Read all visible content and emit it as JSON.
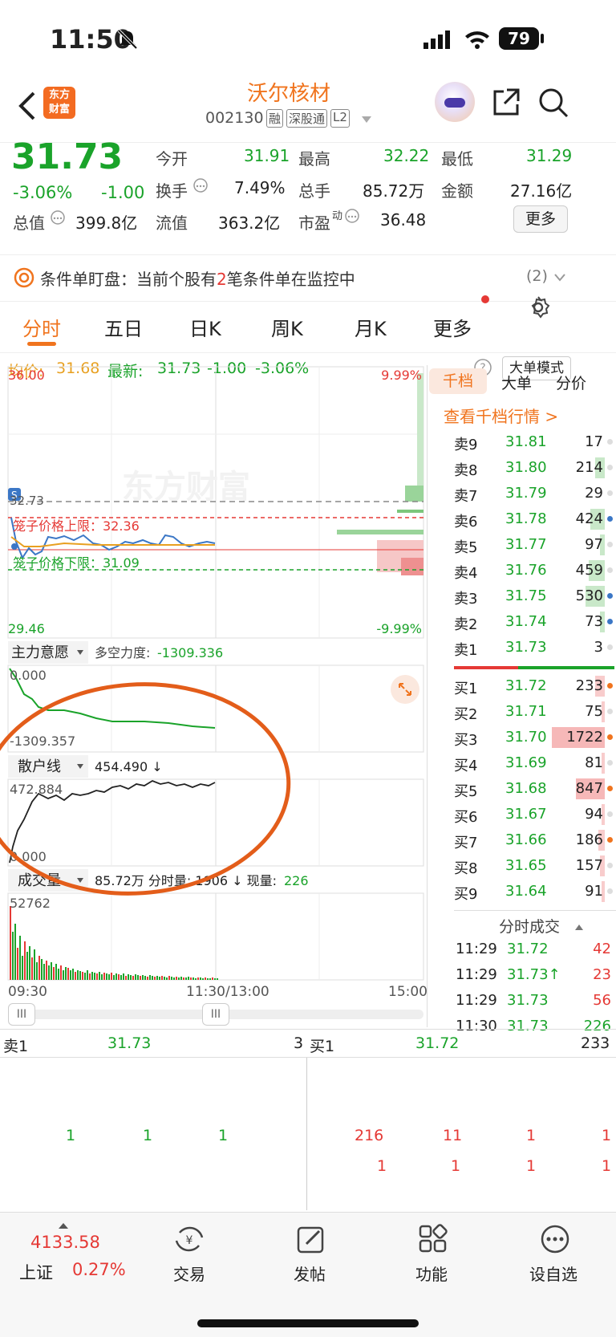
{
  "status": {
    "time": "11:50",
    "battery": "79"
  },
  "header": {
    "logo_line1": "东方",
    "logo_line2": "财富",
    "stock_name": "沃尔核材",
    "code": "002130",
    "tags": [
      "融",
      "深股通",
      "L2"
    ]
  },
  "quote": {
    "price": "31.73",
    "pct": "-3.06%",
    "chg": "-1.00",
    "open_label": "今开",
    "open": "31.91",
    "high_label": "最高",
    "high": "32.22",
    "low_label": "最低",
    "low": "31.29",
    "turnover_label": "换手",
    "turnover": "7.49%",
    "vol_label": "总手",
    "vol": "85.72万",
    "amount_label": "金额",
    "amount": "27.16亿",
    "mcap_label": "总值",
    "mcap": "399.8亿",
    "float_label": "流值",
    "float": "363.2亿",
    "pe_label": "市盈",
    "pe_sup": "动",
    "pe": "36.48",
    "more": "更多"
  },
  "condition": {
    "prefix": "条件单盯盘：",
    "text1": "当前个股有",
    "count": "2",
    "text2": "笔条件单在监控中",
    "badge": "(2)"
  },
  "tabs": [
    "分时",
    "五日",
    "日K",
    "周K",
    "月K",
    "更多"
  ],
  "avg": {
    "avg_label": "均价:",
    "avg": "31.68",
    "new_label": "最新:",
    "new": "31.73",
    "chg": "-1.00",
    "pct": "-3.06%",
    "bigmode": "大单模式"
  },
  "chart": {
    "top_price": "36.00",
    "bottom_price": "29.46",
    "top_pct": "9.99%",
    "bottom_pct": "-9.99%",
    "dash_price": "32.73",
    "upper_label": "笼子价格上限：32.36",
    "lower_label": "笼子价格下限：31.09",
    "main_label": "主力意愿",
    "main_sub_label": "多空力度:",
    "main_sub_val": "-1309.336",
    "main_top": "0.000",
    "main_bot": "-1309.357",
    "retail_label": "散户线",
    "retail_val": "454.490 ↓",
    "retail_top": "472.884",
    "retail_bot": "0.000",
    "vol_label": "成交量",
    "vol_info": "85.72万 分时量: 1906 ↓ 现量:",
    "vol_now": "226",
    "vol_top": "52762",
    "t_start": "09:30",
    "t_mid": "11:30/13:00",
    "t_end": "15:00"
  },
  "side_tabs": [
    "千档",
    "大单",
    "分价"
  ],
  "side_link": "查看千档行情 >",
  "asks": [
    [
      "卖9",
      "31.81",
      "17"
    ],
    [
      "卖8",
      "31.80",
      "214"
    ],
    [
      "卖7",
      "31.79",
      "29"
    ],
    [
      "卖6",
      "31.78",
      "424"
    ],
    [
      "卖5",
      "31.77",
      "97"
    ],
    [
      "卖4",
      "31.76",
      "459"
    ],
    [
      "卖3",
      "31.75",
      "530"
    ],
    [
      "卖2",
      "31.74",
      "73"
    ],
    [
      "卖1",
      "31.73",
      "3"
    ]
  ],
  "bids": [
    [
      "买1",
      "31.72",
      "233"
    ],
    [
      "买2",
      "31.71",
      "75"
    ],
    [
      "买3",
      "31.70",
      "1722"
    ],
    [
      "买4",
      "31.69",
      "81"
    ],
    [
      "买5",
      "31.68",
      "847"
    ],
    [
      "买6",
      "31.67",
      "94"
    ],
    [
      "买7",
      "31.66",
      "186"
    ],
    [
      "买8",
      "31.65",
      "157"
    ],
    [
      "买9",
      "31.64",
      "91"
    ]
  ],
  "ticks_title": "分时成交",
  "ticks": [
    [
      "11:29",
      "31.72",
      "42"
    ],
    [
      "11:29",
      "31.73↑",
      "23"
    ],
    [
      "11:29",
      "31.73",
      "56"
    ],
    [
      "11:30",
      "31.73",
      "226"
    ]
  ],
  "queue": {
    "sell_label": "卖1",
    "sell_price": "31.73",
    "sell_qty": "3",
    "buy_label": "买1",
    "buy_price": "31.72",
    "buy_qty": "233",
    "sell_orders": [
      "1",
      "1",
      "1"
    ],
    "buy_orders_1": [
      "216",
      "11",
      "1",
      "1"
    ],
    "buy_orders_2": [
      "1",
      "1",
      "1",
      "1"
    ]
  },
  "bottom": {
    "index_val": "4133.58",
    "index_name": "上证",
    "index_pct": "0.27%",
    "trade": "交易",
    "post": "发帖",
    "func": "功能",
    "watch": "设自选"
  }
}
